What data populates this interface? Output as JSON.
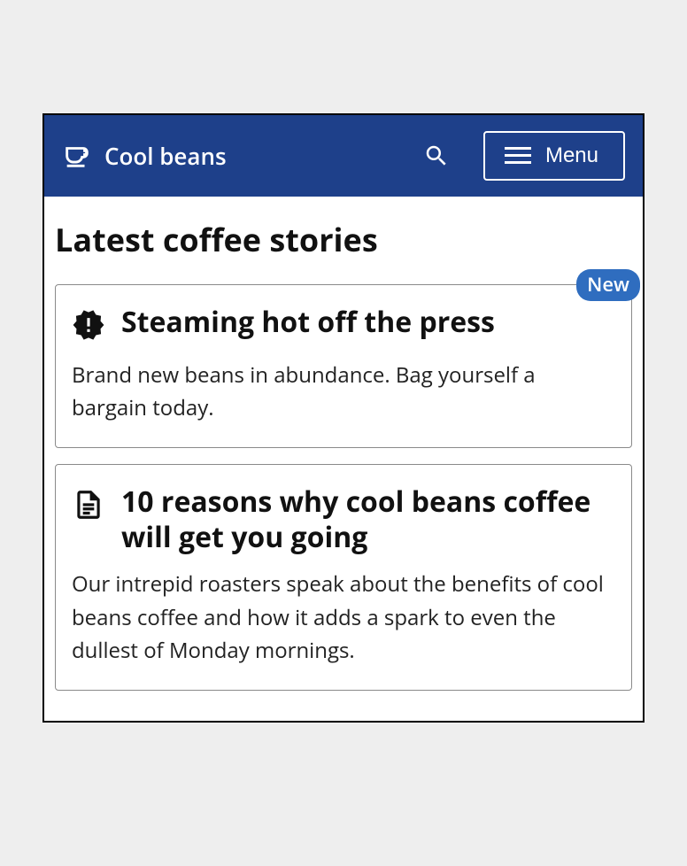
{
  "header": {
    "brand": "Cool beans",
    "menu_label": "Menu"
  },
  "page": {
    "title": "Latest coffee stories"
  },
  "cards": [
    {
      "badge": "New",
      "title": "Steaming hot off the press",
      "body": "Brand new beans in abundance. Bag yourself a bargain today."
    },
    {
      "title": "10 reasons why cool beans coffee will get you going",
      "body": "Our intrepid roasters speak about the benefits of cool beans coffee and how it adds a spark to even the dullest of Monday mornings."
    }
  ]
}
